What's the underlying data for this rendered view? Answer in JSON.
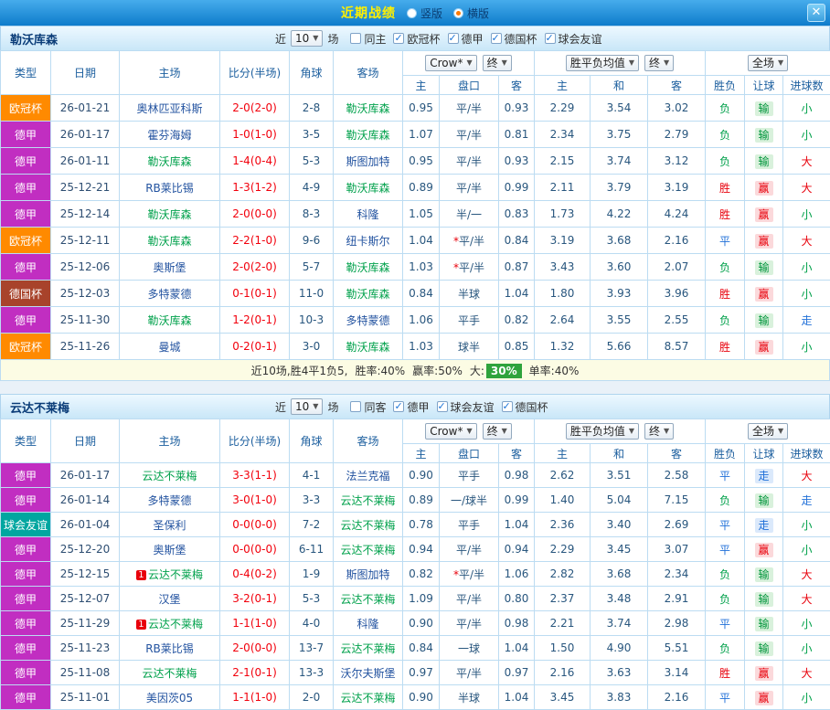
{
  "topbar": {
    "title": "近期战绩",
    "radios": [
      {
        "label": "竖版",
        "selected": false
      },
      {
        "label": "横版",
        "selected": true
      }
    ],
    "close": "✕"
  },
  "columns": {
    "type": "类型",
    "date": "日期",
    "home": "主场",
    "score": "比分(半场)",
    "corner": "角球",
    "away": "客场",
    "sub": [
      "主",
      "盘口",
      "客",
      "主",
      "和",
      "客",
      "胜负",
      "让球",
      "进球数"
    ]
  },
  "dropdowns": {
    "company": "Crow*",
    "final": "终",
    "avg": "胜平负均值",
    "scope": "全场"
  },
  "league_colors": {
    "欧冠杯": "#FF8A00",
    "德甲": "#C12EC1",
    "德国杯": "#A8432B",
    "球会友谊": "#00A6A0"
  },
  "sections": [
    {
      "team": "勒沃库森",
      "filter": {
        "recent_label": "近",
        "count": "10",
        "matches_label": "场",
        "checkboxes": [
          {
            "label": "同主",
            "checked": false
          },
          {
            "label": "欧冠杯",
            "checked": true
          },
          {
            "label": "德甲",
            "checked": true
          },
          {
            "label": "德国杯",
            "checked": true
          },
          {
            "label": "球会友谊",
            "checked": true
          }
        ]
      },
      "rows": [
        {
          "league": "欧冠杯",
          "date": "26-01-21",
          "home": "奥林匹亚科斯",
          "home_focal": false,
          "home_mark": "",
          "score": "2-0(2-0)",
          "corners": "2-8",
          "away": "勒沃库森",
          "away_focal": true,
          "away_mark": "",
          "crown_home": "0.95",
          "handicap": "平/半",
          "crown_away": "0.93",
          "avg_home": "2.29",
          "avg_draw": "3.54",
          "avg_away": "3.02",
          "result": "负",
          "handicap_result": "输",
          "goals_result": "小"
        },
        {
          "league": "德甲",
          "date": "26-01-17",
          "home": "霍芬海姆",
          "home_focal": false,
          "home_mark": "",
          "score": "1-0(1-0)",
          "corners": "3-5",
          "away": "勒沃库森",
          "away_focal": true,
          "away_mark": "",
          "crown_home": "1.07",
          "handicap": "平/半",
          "crown_away": "0.81",
          "avg_home": "2.34",
          "avg_draw": "3.75",
          "avg_away": "2.79",
          "result": "负",
          "handicap_result": "输",
          "goals_result": "小"
        },
        {
          "league": "德甲",
          "date": "26-01-11",
          "home": "勒沃库森",
          "home_focal": true,
          "home_mark": "",
          "score": "1-4(0-4)",
          "corners": "5-3",
          "away": "斯图加特",
          "away_focal": false,
          "away_mark": "",
          "crown_home": "0.95",
          "handicap": "平/半",
          "crown_away": "0.93",
          "avg_home": "2.15",
          "avg_draw": "3.74",
          "avg_away": "3.12",
          "result": "负",
          "handicap_result": "输",
          "goals_result": "大"
        },
        {
          "league": "德甲",
          "date": "25-12-21",
          "home": "RB莱比锡",
          "home_focal": false,
          "home_mark": "",
          "score": "1-3(1-2)",
          "corners": "4-9",
          "away": "勒沃库森",
          "away_focal": true,
          "away_mark": "",
          "crown_home": "0.89",
          "handicap": "平/半",
          "crown_away": "0.99",
          "avg_home": "2.11",
          "avg_draw": "3.79",
          "avg_away": "3.19",
          "result": "胜",
          "handicap_result": "赢",
          "goals_result": "大"
        },
        {
          "league": "德甲",
          "date": "25-12-14",
          "home": "勒沃库森",
          "home_focal": true,
          "home_mark": "",
          "score": "2-0(0-0)",
          "corners": "8-3",
          "away": "科隆",
          "away_focal": false,
          "away_mark": "",
          "crown_home": "1.05",
          "handicap": "半/一",
          "crown_away": "0.83",
          "avg_home": "1.73",
          "avg_draw": "4.22",
          "avg_away": "4.24",
          "result": "胜",
          "handicap_result": "赢",
          "goals_result": "小"
        },
        {
          "league": "欧冠杯",
          "date": "25-12-11",
          "home": "勒沃库森",
          "home_focal": true,
          "home_mark": "",
          "score": "2-2(1-0)",
          "corners": "9-6",
          "away": "纽卡斯尔",
          "away_focal": false,
          "away_mark": "",
          "crown_home": "1.04",
          "handicap": "*平/半",
          "crown_away": "0.84",
          "avg_home": "3.19",
          "avg_draw": "3.68",
          "avg_away": "2.16",
          "result": "平",
          "handicap_result": "赢",
          "goals_result": "大"
        },
        {
          "league": "德甲",
          "date": "25-12-06",
          "home": "奥斯堡",
          "home_focal": false,
          "home_mark": "",
          "score": "2-0(2-0)",
          "corners": "5-7",
          "away": "勒沃库森",
          "away_focal": true,
          "away_mark": "",
          "crown_home": "1.03",
          "handicap": "*平/半",
          "crown_away": "0.87",
          "avg_home": "3.43",
          "avg_draw": "3.60",
          "avg_away": "2.07",
          "result": "负",
          "handicap_result": "输",
          "goals_result": "小"
        },
        {
          "league": "德国杯",
          "date": "25-12-03",
          "home": "多特蒙德",
          "home_focal": false,
          "home_mark": "",
          "score": "0-1(0-1)",
          "corners": "11-0",
          "away": "勒沃库森",
          "away_focal": true,
          "away_mark": "",
          "crown_home": "0.84",
          "handicap": "半球",
          "crown_away": "1.04",
          "avg_home": "1.80",
          "avg_draw": "3.93",
          "avg_away": "3.96",
          "result": "胜",
          "handicap_result": "赢",
          "goals_result": "小"
        },
        {
          "league": "德甲",
          "date": "25-11-30",
          "home": "勒沃库森",
          "home_focal": true,
          "home_mark": "",
          "score": "1-2(0-1)",
          "corners": "10-3",
          "away": "多特蒙德",
          "away_focal": false,
          "away_mark": "",
          "crown_home": "1.06",
          "handicap": "平手",
          "crown_away": "0.82",
          "avg_home": "2.64",
          "avg_draw": "3.55",
          "avg_away": "2.55",
          "result": "负",
          "handicap_result": "输",
          "goals_result": "走"
        },
        {
          "league": "欧冠杯",
          "date": "25-11-26",
          "home": "曼城",
          "home_focal": false,
          "home_mark": "",
          "score": "0-2(0-1)",
          "corners": "3-0",
          "away": "勒沃库森",
          "away_focal": true,
          "away_mark": "",
          "crown_home": "1.03",
          "handicap": "球半",
          "crown_away": "0.85",
          "avg_home": "1.32",
          "avg_draw": "5.66",
          "avg_away": "8.57",
          "result": "胜",
          "handicap_result": "赢",
          "goals_result": "小"
        }
      ],
      "summary": {
        "main": "近10场,胜4平1负5,",
        "win_rate": "胜率:40%",
        "cover_rate": "赢率:50%",
        "big_label": "大:",
        "big_value": "30%",
        "single_rate": "单率:40%"
      }
    },
    {
      "team": "云达不莱梅",
      "filter": {
        "recent_label": "近",
        "count": "10",
        "matches_label": "场",
        "checkboxes": [
          {
            "label": "同客",
            "checked": false
          },
          {
            "label": "德甲",
            "checked": true
          },
          {
            "label": "球会友谊",
            "checked": true
          },
          {
            "label": "德国杯",
            "checked": true
          }
        ]
      },
      "rows": [
        {
          "league": "德甲",
          "date": "26-01-17",
          "home": "云达不莱梅",
          "home_focal": true,
          "home_mark": "",
          "score": "3-3(1-1)",
          "corners": "4-1",
          "away": "法兰克福",
          "away_focal": false,
          "away_mark": "",
          "crown_home": "0.90",
          "handicap": "平手",
          "crown_away": "0.98",
          "avg_home": "2.62",
          "avg_draw": "3.51",
          "avg_away": "2.58",
          "result": "平",
          "handicap_result": "走",
          "goals_result": "大"
        },
        {
          "league": "德甲",
          "date": "26-01-14",
          "home": "多特蒙德",
          "home_focal": false,
          "home_mark": "",
          "score": "3-0(1-0)",
          "corners": "3-3",
          "away": "云达不莱梅",
          "away_focal": true,
          "away_mark": "",
          "crown_home": "0.89",
          "handicap": "一/球半",
          "crown_away": "0.99",
          "avg_home": "1.40",
          "avg_draw": "5.04",
          "avg_away": "7.15",
          "result": "负",
          "handicap_result": "输",
          "goals_result": "走"
        },
        {
          "league": "球会友谊",
          "date": "26-01-04",
          "home": "圣保利",
          "home_focal": false,
          "home_mark": "",
          "score": "0-0(0-0)",
          "corners": "7-2",
          "away": "云达不莱梅",
          "away_focal": true,
          "away_mark": "",
          "crown_home": "0.78",
          "handicap": "平手",
          "crown_away": "1.04",
          "avg_home": "2.36",
          "avg_draw": "3.40",
          "avg_away": "2.69",
          "result": "平",
          "handicap_result": "走",
          "goals_result": "小"
        },
        {
          "league": "德甲",
          "date": "25-12-20",
          "home": "奥斯堡",
          "home_focal": false,
          "home_mark": "",
          "score": "0-0(0-0)",
          "corners": "6-11",
          "away": "云达不莱梅",
          "away_focal": true,
          "away_mark": "",
          "crown_home": "0.94",
          "handicap": "平/半",
          "crown_away": "0.94",
          "avg_home": "2.29",
          "avg_draw": "3.45",
          "avg_away": "3.07",
          "result": "平",
          "handicap_result": "赢",
          "goals_result": "小"
        },
        {
          "league": "德甲",
          "date": "25-12-15",
          "home": "云达不莱梅",
          "home_focal": true,
          "home_mark": "1",
          "score": "0-4(0-2)",
          "corners": "1-9",
          "away": "斯图加特",
          "away_focal": false,
          "away_mark": "",
          "crown_home": "0.82",
          "handicap": "*平/半",
          "crown_away": "1.06",
          "avg_home": "2.82",
          "avg_draw": "3.68",
          "avg_away": "2.34",
          "result": "负",
          "handicap_result": "输",
          "goals_result": "大"
        },
        {
          "league": "德甲",
          "date": "25-12-07",
          "home": "汉堡",
          "home_focal": false,
          "home_mark": "",
          "score": "3-2(0-1)",
          "corners": "5-3",
          "away": "云达不莱梅",
          "away_focal": true,
          "away_mark": "",
          "crown_home": "1.09",
          "handicap": "平/半",
          "crown_away": "0.80",
          "avg_home": "2.37",
          "avg_draw": "3.48",
          "avg_away": "2.91",
          "result": "负",
          "handicap_result": "输",
          "goals_result": "大"
        },
        {
          "league": "德甲",
          "date": "25-11-29",
          "home": "云达不莱梅",
          "home_focal": true,
          "home_mark": "1",
          "score": "1-1(1-0)",
          "corners": "4-0",
          "away": "科隆",
          "away_focal": false,
          "away_mark": "",
          "crown_home": "0.90",
          "handicap": "平/半",
          "crown_away": "0.98",
          "avg_home": "2.21",
          "avg_draw": "3.74",
          "avg_away": "2.98",
          "result": "平",
          "handicap_result": "输",
          "goals_result": "小"
        },
        {
          "league": "德甲",
          "date": "25-11-23",
          "home": "RB莱比锡",
          "home_focal": false,
          "home_mark": "",
          "score": "2-0(0-0)",
          "corners": "13-7",
          "away": "云达不莱梅",
          "away_focal": true,
          "away_mark": "",
          "crown_home": "0.84",
          "handicap": "一球",
          "crown_away": "1.04",
          "avg_home": "1.50",
          "avg_draw": "4.90",
          "avg_away": "5.51",
          "result": "负",
          "handicap_result": "输",
          "goals_result": "小"
        },
        {
          "league": "德甲",
          "date": "25-11-08",
          "home": "云达不莱梅",
          "home_focal": true,
          "home_mark": "",
          "score": "2-1(0-1)",
          "corners": "13-3",
          "away": "沃尔夫斯堡",
          "away_focal": false,
          "away_mark": "",
          "crown_home": "0.97",
          "handicap": "平/半",
          "crown_away": "0.97",
          "avg_home": "2.16",
          "avg_draw": "3.63",
          "avg_away": "3.14",
          "result": "胜",
          "handicap_result": "赢",
          "goals_result": "大"
        },
        {
          "league": "德甲",
          "date": "25-11-01",
          "home": "美因茨05",
          "home_focal": false,
          "home_mark": "",
          "score": "1-1(1-0)",
          "corners": "2-0",
          "away": "云达不莱梅",
          "away_focal": true,
          "away_mark": "",
          "crown_home": "0.90",
          "handicap": "半球",
          "crown_away": "1.04",
          "avg_home": "3.45",
          "avg_draw": "3.83",
          "avg_away": "2.16",
          "result": "平",
          "handicap_result": "赢",
          "goals_result": "小"
        }
      ],
      "summary": null
    }
  ]
}
